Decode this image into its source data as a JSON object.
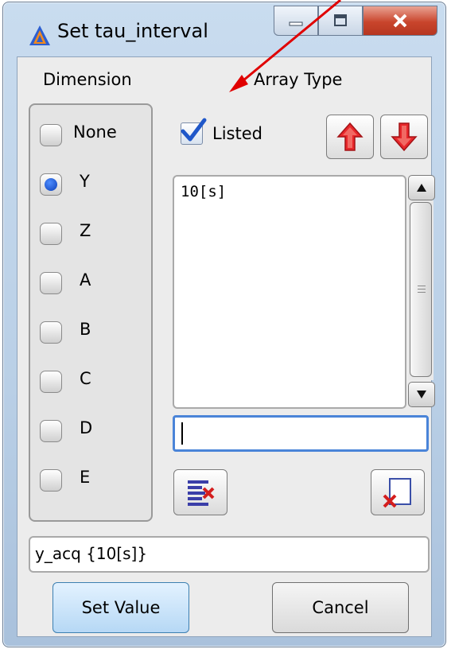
{
  "window": {
    "title": "Set tau_interval"
  },
  "labels": {
    "dimension": "Dimension",
    "array_type": "Array Type"
  },
  "dimensions": [
    {
      "label": "None",
      "selected": false
    },
    {
      "label": "Y",
      "selected": true
    },
    {
      "label": "Z",
      "selected": false
    },
    {
      "label": "A",
      "selected": false
    },
    {
      "label": "B",
      "selected": false
    },
    {
      "label": "C",
      "selected": false
    },
    {
      "label": "D",
      "selected": false
    },
    {
      "label": "E",
      "selected": false
    }
  ],
  "array_type": {
    "listed_label": "Listed",
    "listed_checked": true
  },
  "list": {
    "items": [
      "10[s]"
    ]
  },
  "input": {
    "value": ""
  },
  "status": {
    "text": "y_acq {10[s]}"
  },
  "buttons": {
    "set_value": "Set Value",
    "cancel": "Cancel"
  },
  "colors": {
    "accent_red": "#e8262a",
    "radio_blue": "#0d3fb8",
    "annotation_arrow": "#e00000"
  }
}
